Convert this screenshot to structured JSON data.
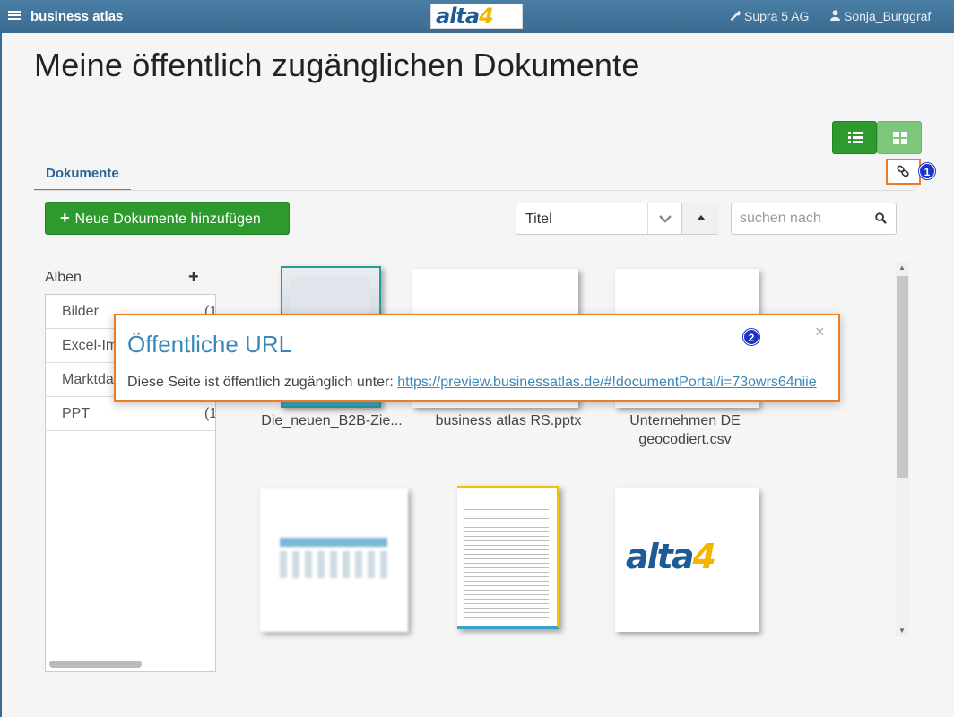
{
  "header": {
    "brand": "business atlas",
    "logo_main": "alta",
    "logo_accent": "4",
    "tenant": "Supra 5 AG",
    "tenant_icon": "wrench-icon",
    "user": "Sonja_Burggraf",
    "user_icon": "user-icon"
  },
  "page": {
    "title": "Meine öffentlich zugänglichen Dokumente"
  },
  "tabs": [
    {
      "label": "Dokumente",
      "active": true
    }
  ],
  "toolbar": {
    "add_label": "Neue Dokumente hinzufügen",
    "sort_value": "Titel",
    "search_placeholder": "suchen nach"
  },
  "view_toggle": {
    "active": "list",
    "colors": {
      "active": "#2d9a2d",
      "inactive": "#7dc77d"
    }
  },
  "badges": [
    "1",
    "2"
  ],
  "albums": {
    "heading": "Alben",
    "items": [
      {
        "label": "Bilder",
        "count": "(1"
      },
      {
        "label": "Excel-Im",
        "count": ""
      },
      {
        "label": "Marktda",
        "count": ""
      },
      {
        "label": "PPT",
        "count": "(1"
      }
    ]
  },
  "documents": [
    {
      "caption": "Die_neuen_B2B-Zie..."
    },
    {
      "caption": "business atlas RS.pptx"
    },
    {
      "caption": "Unternehmen DE geocodiert.csv"
    },
    {
      "caption": ""
    },
    {
      "caption": ""
    },
    {
      "caption": ""
    }
  ],
  "doc_thumb_logo": {
    "main": "alta",
    "accent": "4"
  },
  "popup": {
    "title": "Öffentliche URL",
    "text": "Diese Seite ist öffentlich zugänglich unter: ",
    "url": "https://preview.businessatlas.de/#!documentPortal/i=73owrs64niie"
  },
  "colors": {
    "accent_green": "#2d9a2d",
    "header_blue": "#3b6b91",
    "highlight_orange": "#ec7d22",
    "badge_blue": "#1a33c8"
  }
}
